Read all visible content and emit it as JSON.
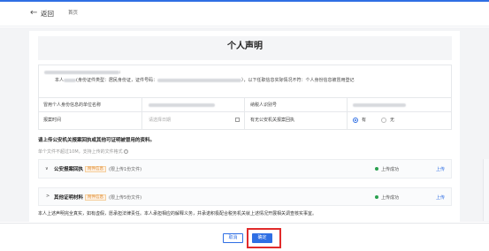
{
  "header": {
    "back_label": "返回",
    "home_label": "首页",
    "accent": "#2f6fe4"
  },
  "declaration": {
    "title": "个人声明",
    "greeting_suffix": ":",
    "line_prefix": "本人",
    "id_type_label": "(身份证件类型：居民身份证，证件号码：",
    "line_suffix": "），以下任职信息实际情况不符：个人身份信息被冒用登记"
  },
  "form": {
    "employer_label": "冒用个人身份信息的单位名称",
    "taxpayer_id_label": "纳税人识别号",
    "report_time_label": "报案时间",
    "date_placeholder": "请选择日期",
    "receipt_label": "有无公安机关报案回执",
    "radio_yes": "有",
    "radio_no": "无",
    "radio_selected": "yes"
  },
  "upload": {
    "instruction": "请上传公安机关报案回执或其他可证明被冒用的资料。",
    "hint": "单个文件不超过10M，支持上传的文件格式",
    "items": [
      {
        "title": "公安报案回执",
        "tag": "附件信息",
        "limit": "(限上传1份文件)",
        "status": "上传成功",
        "action": "上传"
      },
      {
        "title": "其他证明材料",
        "tag": "附件信息",
        "limit": "(限上传5份文件)",
        "status": "上传成功",
        "action": "上传"
      }
    ]
  },
  "commitment": "本人上述声明完全真实，如有虚假，愿承担法律责任。本人承担相应的解释义务，并承诺积极配合税务机关就上述情况开展相关调查核实事宜。",
  "footer": {
    "cancel_label": "取消",
    "confirm_label": "确定"
  }
}
